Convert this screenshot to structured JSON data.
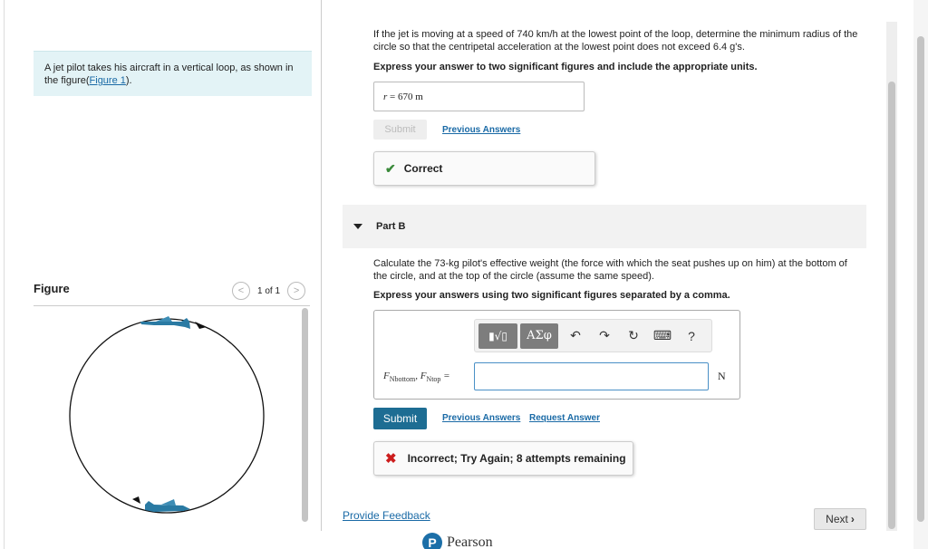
{
  "intro": {
    "text": "A jet pilot takes his aircraft in a vertical loop, as shown in the figure(",
    "link": "Figure 1",
    "suffix": ")."
  },
  "figure": {
    "title": "Figure",
    "pager": "1 of 1",
    "prev_icon": "chevron-left-icon",
    "next_icon": "chevron-right-icon"
  },
  "partA": {
    "question": "If the jet is moving at a speed of 740 km/h at the lowest point of the loop, determine the minimum radius of the circle so that the centripetal acceleration at the lowest point does not exceed 6.4 g's.",
    "instruction": "Express your answer to two significant figures and include the appropriate units.",
    "answer_var": "r",
    "answer_eq": " =  670 m",
    "submit_label": "Submit",
    "previous_answers": "Previous Answers",
    "feedback": "Correct"
  },
  "partB": {
    "header": "Part B",
    "question": "Calculate the 73-kg pilot's effective weight (the force with which the seat pushes up on him) at the bottom of the circle, and at the top of the circle (assume the same speed).",
    "instruction": "Express your answers using two significant figures separated by a comma.",
    "toolbar": {
      "templates_label": "▮√▯",
      "greek_label": "ΑΣφ",
      "undo_icon": "undo-icon",
      "redo_icon": "redo-icon",
      "reset_icon": "reset-icon",
      "keyboard_icon": "keyboard-icon",
      "help_label": "?"
    },
    "label_f1": "F",
    "label_sub1": "Nbottom",
    "label_sep": ", F",
    "label_sub2": "Ntop",
    "label_eq": " =",
    "input_value": "",
    "unit": "N",
    "submit_label": "Submit",
    "previous_answers": "Previous Answers",
    "request_answer": "Request Answer",
    "feedback": "Incorrect; Try Again; 8 attempts remaining"
  },
  "footer": {
    "provide_feedback": "Provide Feedback",
    "next_label": "Next",
    "brand": "Pearson"
  },
  "colors": {
    "accent": "#1d6d93",
    "link": "#1a6aa6",
    "correct": "#3a8a3a",
    "incorrect": "#cc1d1d",
    "intro_bg": "#e3f3f6"
  }
}
